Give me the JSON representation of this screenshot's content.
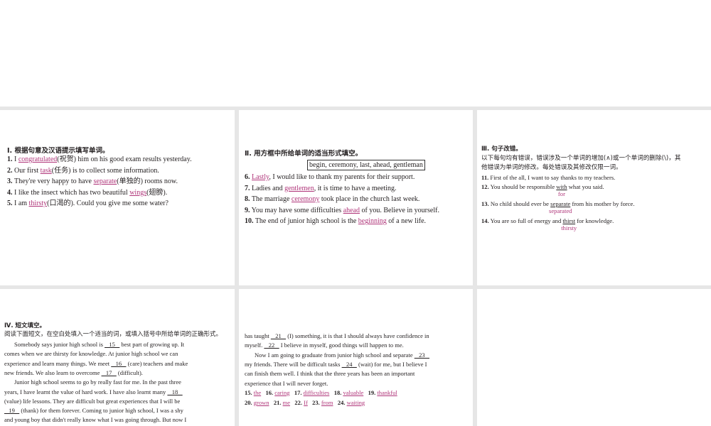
{
  "section1": {
    "heading": "Ⅰ. 根据句意及汉语提示填写单词。",
    "items": [
      {
        "num": "1.",
        "pre": "I ",
        "ans": "congratulated",
        "post": "(祝贺) him on his good exam results yesterday."
      },
      {
        "num": "2.",
        "pre": "Our first ",
        "ans": "task",
        "post": "(任务) is to collect some information."
      },
      {
        "num": "3.",
        "pre": "They're very happy to have ",
        "ans": "separate",
        "post": "(单独的) rooms now."
      },
      {
        "num": "4.",
        "pre": "I like the insect which has two beautiful ",
        "ans": "wings",
        "post": "(翅膀)."
      },
      {
        "num": "5.",
        "pre": "I am ",
        "ans": "thirsty",
        "post": "(口渴的). Could you give me some water?"
      }
    ]
  },
  "section2": {
    "heading": "Ⅱ. 用方框中所给单词的适当形式填空。",
    "word_box": "begin, ceremony, last, ahead, gentleman",
    "items": [
      {
        "num": "6.",
        "pre": " ",
        "ans": "Lastly",
        "post": ", I would like to thank my parents for their support."
      },
      {
        "num": "7.",
        "pre": " Ladies and ",
        "ans": "gentlemen",
        "post": ", it is time to have a meeting."
      },
      {
        "num": "8.",
        "pre": " The marriage ",
        "ans": "ceremony",
        "post": " took place in the church last week."
      },
      {
        "num": "9.",
        "pre": " You may have some difficulties ",
        "ans": "ahead",
        "post": " of you. Believe in yourself."
      },
      {
        "num": "10.",
        "pre": " The end of junior high school is the ",
        "ans": "beginning",
        "post": " of a new life."
      }
    ]
  },
  "section3": {
    "heading": "Ⅲ. 句子改错。",
    "instruction_1": "以下每句均有错误，错误涉及一个单词的增加(∧)或一个单词的删除(\\)，其",
    "instruction_2": "他错误为单词的修改。每处错误及其修改仅限一词。",
    "items": [
      {
        "num": "11.",
        "text": " First of the all, I want to say thanks to my teachers."
      },
      {
        "num": "12.",
        "pre": " You should be responsible ",
        "orig": "with",
        "post": " what you said.",
        "fix": "for"
      },
      {
        "num": "13.",
        "pre": " No child should ever be ",
        "orig": "separate",
        "post": " from his mother by force.",
        "fix": "separated"
      },
      {
        "num": "14.",
        "pre": " You are so full of energy and ",
        "orig": "thirst",
        "post": " for knowledge.",
        "fix": "thirsty"
      }
    ]
  },
  "section4": {
    "heading": "Ⅳ. 短文填空。",
    "instruction": "阅读下面短文，在空白处填入一个适当的词，或填入括号中所给单词的正确形式。",
    "lines": [
      "Somebody says junior high school is __15__ best part of growing up. It",
      "comes when we are thirsty for knowledge. At junior high school we can",
      "experience and learn many things. We meet __16__ (care) teachers and make",
      "new friends. We also learn to overcome __17__ (difficult).",
      "Junior high school seems to go by really fast for me. In the past three",
      "years, I have learnt the value of hard work. I have also learnt many __18__",
      "(value) life lessons. They are difficult but great experiences that I will be",
      "__19__ (thank) for them forever. Coming to junior high school, I was a shy",
      "and young boy that didn't really know what I was going through. But now I"
    ]
  },
  "section5": {
    "lines": [
      "has taught __21__ (I) something, it is that I should always have confidence in",
      "myself. __22__ I believe in myself, good things will happen to me.",
      "Now I am going to graduate from junior high school and separate __23__",
      "my friends. There will be difficult tasks __24__ (wait) for me, but I believe I",
      "can finish them well. I think that the three years has been an important",
      "experience that I will never forget."
    ],
    "answers_row1": [
      {
        "num": "15.",
        "ans": "the"
      },
      {
        "num": "16.",
        "ans": "caring"
      },
      {
        "num": "17.",
        "ans": "difficulties"
      },
      {
        "num": "18.",
        "ans": "valuable"
      },
      {
        "num": "19.",
        "ans": "thankful"
      }
    ],
    "answers_row2": [
      {
        "num": "20.",
        "ans": "grown"
      },
      {
        "num": "21.",
        "ans": "me"
      },
      {
        "num": "22.",
        "ans": "If"
      },
      {
        "num": "23.",
        "ans": "from"
      },
      {
        "num": "24.",
        "ans": "waiting"
      }
    ]
  }
}
